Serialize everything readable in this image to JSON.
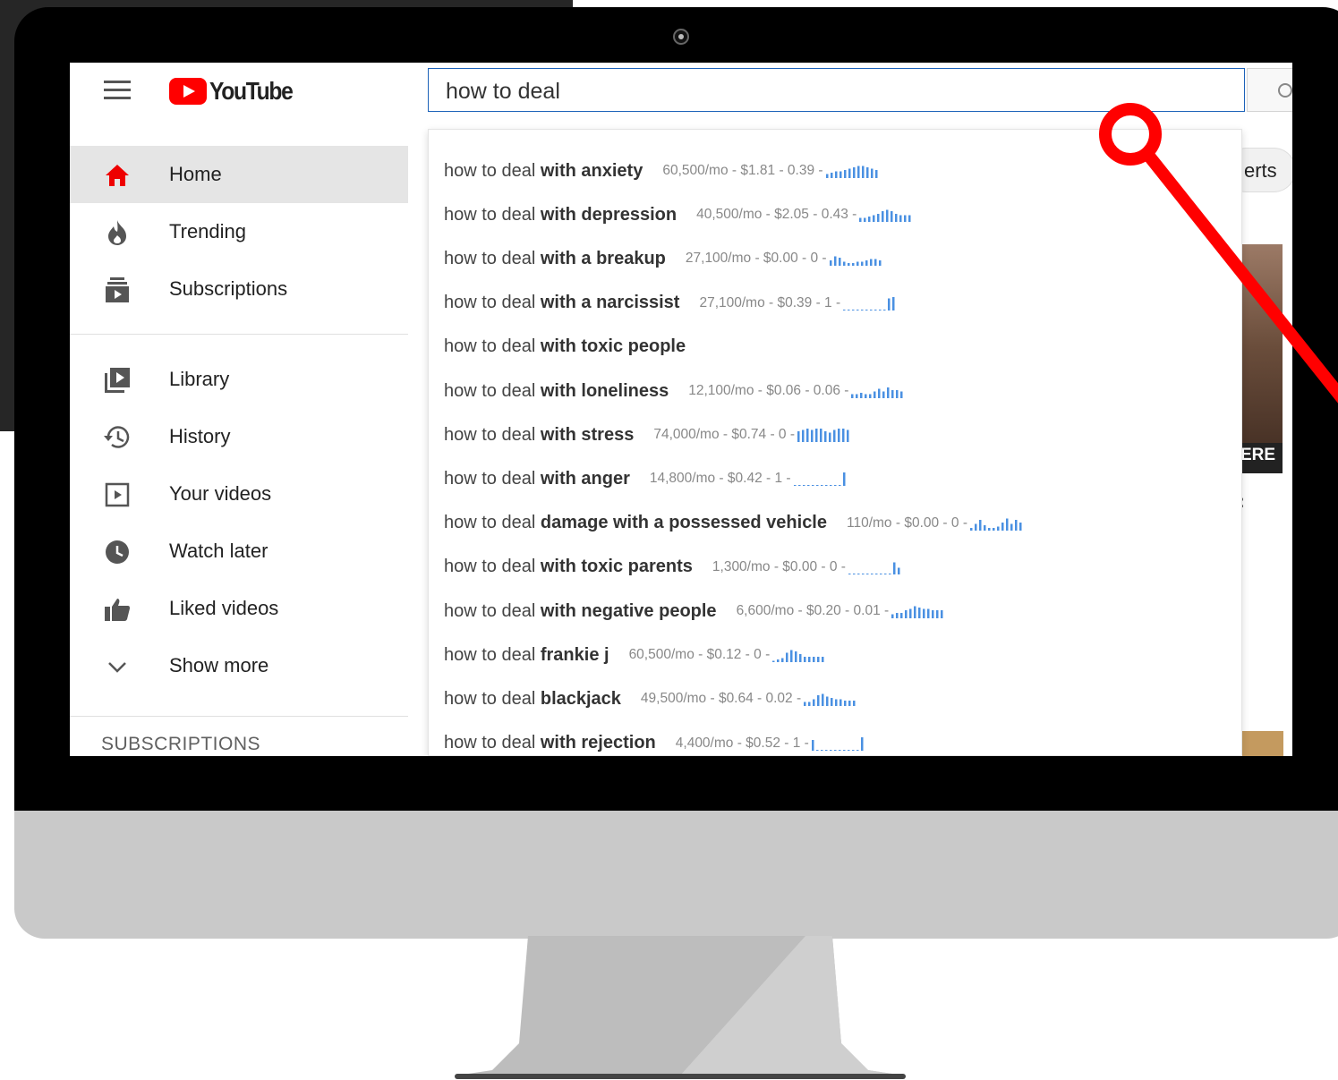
{
  "app": {
    "logo_text": "YouTube"
  },
  "search": {
    "query": "how to deal"
  },
  "sidebar": {
    "items": [
      {
        "label": "Home",
        "icon": "home-icon",
        "active": true
      },
      {
        "label": "Trending",
        "icon": "flame-icon"
      },
      {
        "label": "Subscriptions",
        "icon": "subscriptions-icon"
      },
      {
        "label": "Library",
        "icon": "library-icon"
      },
      {
        "label": "History",
        "icon": "history-icon"
      },
      {
        "label": "Your videos",
        "icon": "your-videos-icon"
      },
      {
        "label": "Watch later",
        "icon": "clock-icon"
      },
      {
        "label": "Liked videos",
        "icon": "thumbs-up-icon"
      },
      {
        "label": "Show more",
        "icon": "chevron-down-icon"
      }
    ],
    "subscriptions_heading": "SUBSCRIPTIONS"
  },
  "background": {
    "chip_label": "erts",
    "thumb_label": "ERE",
    "colon": ":"
  },
  "suggestions": [
    {
      "prefix": "how to deal",
      "rest": " with anxiety",
      "stats": "60,500/mo - $1.81 - 0.39 -",
      "trend": [
        3,
        4,
        5,
        5,
        6,
        7,
        8,
        9,
        9,
        8,
        7,
        6
      ]
    },
    {
      "prefix": "how to deal",
      "rest": " with depression",
      "stats": "40,500/mo - $2.05 - 0.43 -",
      "trend": [
        3,
        3,
        4,
        5,
        6,
        8,
        9,
        8,
        6,
        5,
        5,
        5
      ]
    },
    {
      "prefix": "how to deal",
      "rest": " with a breakup",
      "stats": "27,100/mo - $0.00 - 0 -",
      "trend": [
        4,
        7,
        6,
        3,
        2,
        2,
        3,
        3,
        4,
        5,
        5,
        4
      ]
    },
    {
      "prefix": "how to deal",
      "rest": " with a narcissist",
      "stats": "27,100/mo - $0.39 - 1 -",
      "trend": [
        0,
        0,
        0,
        0,
        0,
        0,
        0,
        0,
        0,
        0,
        9,
        10
      ]
    },
    {
      "prefix": "how to deal",
      "rest": " with toxic people",
      "stats": "",
      "trend": []
    },
    {
      "prefix": "how to deal",
      "rest": " with loneliness",
      "stats": "12,100/mo - $0.06 - 0.06 -",
      "trend": [
        3,
        3,
        4,
        3,
        3,
        5,
        7,
        5,
        8,
        6,
        6,
        5
      ]
    },
    {
      "prefix": "how to deal",
      "rest": " with stress",
      "stats": "74,000/mo - $0.74 - 0 -",
      "trend": [
        8,
        9,
        10,
        9,
        10,
        10,
        8,
        7,
        9,
        10,
        10,
        9
      ]
    },
    {
      "prefix": "how to deal",
      "rest": " with anger",
      "stats": "14,800/mo - $0.42 - 1 -",
      "trend": [
        0,
        0,
        0,
        0,
        0,
        0,
        0,
        0,
        0,
        0,
        0,
        10
      ]
    },
    {
      "prefix": "how to deal",
      "rest": " damage with a possessed vehicle",
      "stats": "110/mo - $0.00 - 0 -",
      "trend": [
        2,
        5,
        8,
        4,
        2,
        2,
        3,
        6,
        9,
        5,
        8,
        6
      ]
    },
    {
      "prefix": "how to deal",
      "rest": " with toxic parents",
      "stats": "1,300/mo - $0.00 - 0 -",
      "trend": [
        0,
        0,
        0,
        0,
        0,
        0,
        0,
        0,
        0,
        0,
        9,
        5
      ]
    },
    {
      "prefix": "how to deal",
      "rest": " with negative people",
      "stats": "6,600/mo - $0.20 - 0.01 -",
      "trend": [
        3,
        4,
        4,
        6,
        7,
        9,
        8,
        7,
        7,
        6,
        6,
        6
      ]
    },
    {
      "prefix": "how to deal",
      "rest": " frankie j",
      "stats": "60,500/mo - $0.12 - 0 -",
      "trend": [
        1,
        2,
        3,
        7,
        9,
        8,
        6,
        4,
        4,
        4,
        4,
        4
      ]
    },
    {
      "prefix": "how to deal",
      "rest": " blackjack",
      "stats": "49,500/mo - $0.64 - 0.02 -",
      "trend": [
        3,
        3,
        5,
        8,
        9,
        7,
        6,
        5,
        5,
        4,
        4,
        4
      ]
    },
    {
      "prefix": "how to deal",
      "rest": " with rejection",
      "stats": "4,400/mo - $0.52 - 1 -",
      "trend": [
        8,
        0,
        0,
        0,
        0,
        0,
        0,
        0,
        0,
        0,
        0,
        10
      ]
    }
  ],
  "colors": {
    "youtube_red": "#ff0000",
    "search_border": "#1c62b9",
    "trend_bar": "#4a90e2",
    "annotation_red": "#ff0000"
  }
}
